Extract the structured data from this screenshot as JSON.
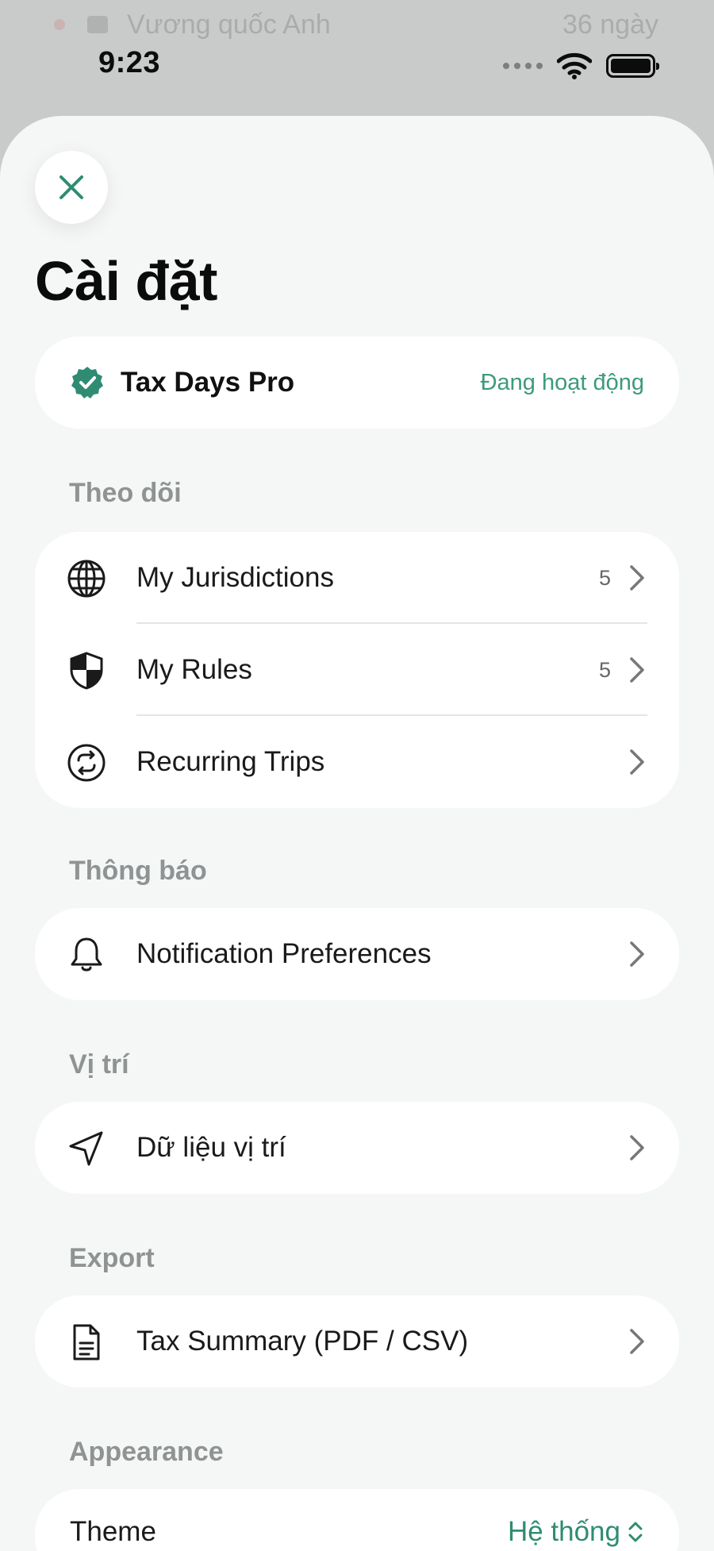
{
  "background": {
    "country_text": "Vương quốc Anh",
    "days_text": "36 ngày"
  },
  "status_bar": {
    "time": "9:23"
  },
  "title": "Cài đặt",
  "pro": {
    "name": "Tax Days Pro",
    "status": "Đang hoạt động"
  },
  "sections": {
    "tracking": {
      "label": "Theo dõi",
      "items": [
        {
          "label": "My Jurisdictions",
          "count": "5",
          "icon": "globe-icon"
        },
        {
          "label": "My Rules",
          "count": "5",
          "icon": "shield-icon"
        },
        {
          "label": "Recurring Trips",
          "icon": "repeat-icon"
        }
      ]
    },
    "notifications": {
      "label": "Thông báo",
      "items": [
        {
          "label": "Notification Preferences",
          "icon": "bell-icon"
        }
      ]
    },
    "location": {
      "label": "Vị trí",
      "items": [
        {
          "label": "Dữ liệu vị trí",
          "icon": "location-arrow-icon"
        }
      ]
    },
    "export": {
      "label": "Export",
      "items": [
        {
          "label": "Tax Summary (PDF / CSV)",
          "icon": "document-icon"
        }
      ]
    },
    "appearance": {
      "label": "Appearance",
      "theme_label": "Theme",
      "theme_value": "Hệ thống"
    }
  },
  "colors": {
    "accent": "#2f8c72",
    "sheet_bg": "#f5f6f6",
    "card_bg": "#ffffff"
  }
}
